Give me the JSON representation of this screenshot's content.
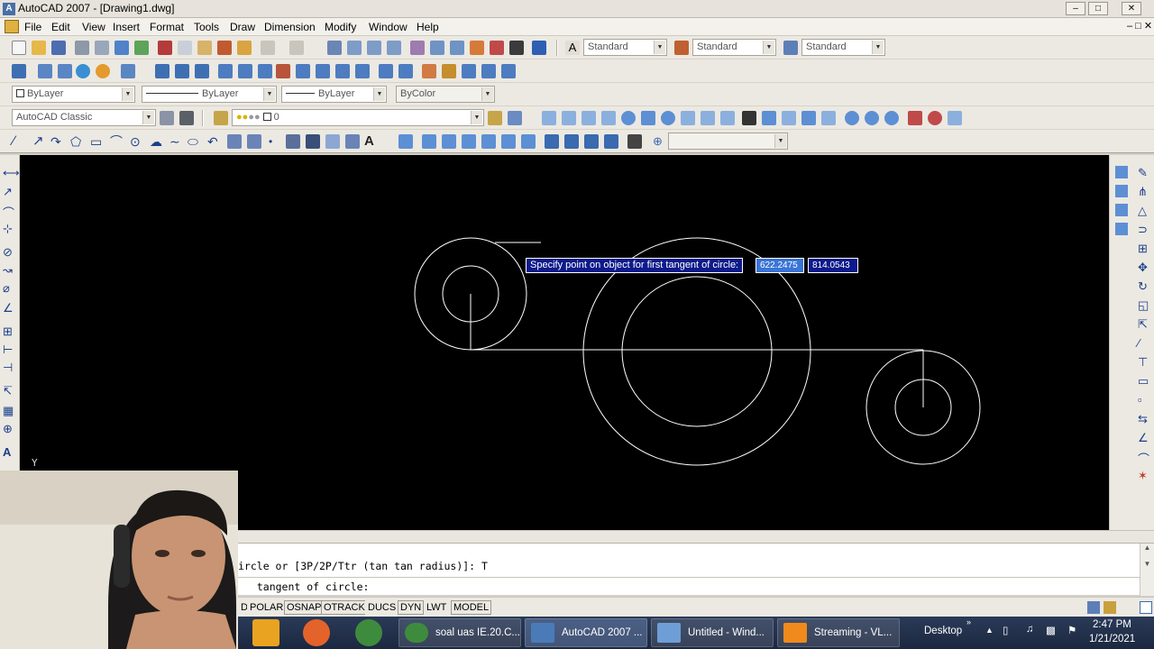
{
  "window": {
    "title": "AutoCAD 2007 - [Drawing1.dwg]",
    "app_icon_letter": "A"
  },
  "menu": [
    "File",
    "Edit",
    "View",
    "Insert",
    "Format",
    "Tools",
    "Draw",
    "Dimension",
    "Modify",
    "Window",
    "Help"
  ],
  "styles_toolbar": {
    "text_style": "Standard",
    "dim_style": "Standard",
    "table_style": "Standard"
  },
  "properties_toolbar": {
    "color": "ByLayer",
    "linetype": "ByLayer",
    "lineweight": "ByLayer",
    "plot_style": "ByColor"
  },
  "workspace": "AutoCAD Classic",
  "layer": "0",
  "canvas": {
    "prompt_tooltip": "Specify point on object for first tangent of circle:",
    "coord_x": "622.2475",
    "coord_y": "814.0543",
    "ucs_label": "Y",
    "background": "#000000",
    "stroke": "#ffffff"
  },
  "command": {
    "history_line": "ircle or [3P/2P/Ttr (tan tan radius)]: T",
    "current_prompt": "  tangent of circle:"
  },
  "status_buttons": [
    "D",
    "POLAR",
    "OSNAP",
    "OTRACK",
    "DUCS",
    "DYN",
    "LWT",
    "MODEL"
  ],
  "taskbar": {
    "items": [
      {
        "label": "soal uas IE.20.C...",
        "icon": "chrome-icon"
      },
      {
        "label": "AutoCAD 2007 ...",
        "icon": "autocad-icon",
        "active": true
      },
      {
        "label": "Untitled - Wind...",
        "icon": "movie-maker-icon"
      },
      {
        "label": "Streaming - VL...",
        "icon": "vlc-icon"
      }
    ],
    "desktop_label": "Desktop",
    "time": "2:47 PM",
    "date": "1/21/2021"
  }
}
